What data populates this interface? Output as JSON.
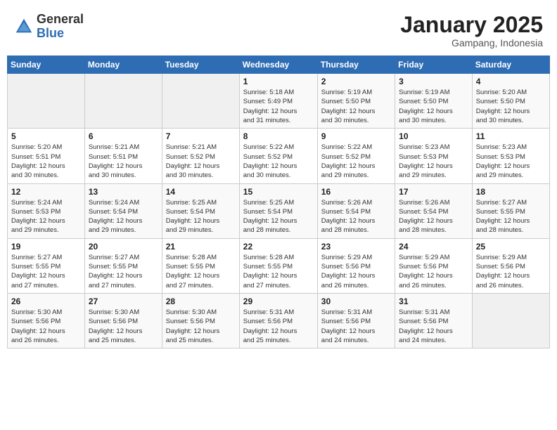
{
  "header": {
    "logo_general": "General",
    "logo_blue": "Blue",
    "month_title": "January 2025",
    "location": "Gampang, Indonesia"
  },
  "weekdays": [
    "Sunday",
    "Monday",
    "Tuesday",
    "Wednesday",
    "Thursday",
    "Friday",
    "Saturday"
  ],
  "weeks": [
    [
      {
        "day": "",
        "info": ""
      },
      {
        "day": "",
        "info": ""
      },
      {
        "day": "",
        "info": ""
      },
      {
        "day": "1",
        "info": "Sunrise: 5:18 AM\nSunset: 5:49 PM\nDaylight: 12 hours\nand 31 minutes."
      },
      {
        "day": "2",
        "info": "Sunrise: 5:19 AM\nSunset: 5:50 PM\nDaylight: 12 hours\nand 30 minutes."
      },
      {
        "day": "3",
        "info": "Sunrise: 5:19 AM\nSunset: 5:50 PM\nDaylight: 12 hours\nand 30 minutes."
      },
      {
        "day": "4",
        "info": "Sunrise: 5:20 AM\nSunset: 5:50 PM\nDaylight: 12 hours\nand 30 minutes."
      }
    ],
    [
      {
        "day": "5",
        "info": "Sunrise: 5:20 AM\nSunset: 5:51 PM\nDaylight: 12 hours\nand 30 minutes."
      },
      {
        "day": "6",
        "info": "Sunrise: 5:21 AM\nSunset: 5:51 PM\nDaylight: 12 hours\nand 30 minutes."
      },
      {
        "day": "7",
        "info": "Sunrise: 5:21 AM\nSunset: 5:52 PM\nDaylight: 12 hours\nand 30 minutes."
      },
      {
        "day": "8",
        "info": "Sunrise: 5:22 AM\nSunset: 5:52 PM\nDaylight: 12 hours\nand 30 minutes."
      },
      {
        "day": "9",
        "info": "Sunrise: 5:22 AM\nSunset: 5:52 PM\nDaylight: 12 hours\nand 29 minutes."
      },
      {
        "day": "10",
        "info": "Sunrise: 5:23 AM\nSunset: 5:53 PM\nDaylight: 12 hours\nand 29 minutes."
      },
      {
        "day": "11",
        "info": "Sunrise: 5:23 AM\nSunset: 5:53 PM\nDaylight: 12 hours\nand 29 minutes."
      }
    ],
    [
      {
        "day": "12",
        "info": "Sunrise: 5:24 AM\nSunset: 5:53 PM\nDaylight: 12 hours\nand 29 minutes."
      },
      {
        "day": "13",
        "info": "Sunrise: 5:24 AM\nSunset: 5:54 PM\nDaylight: 12 hours\nand 29 minutes."
      },
      {
        "day": "14",
        "info": "Sunrise: 5:25 AM\nSunset: 5:54 PM\nDaylight: 12 hours\nand 29 minutes."
      },
      {
        "day": "15",
        "info": "Sunrise: 5:25 AM\nSunset: 5:54 PM\nDaylight: 12 hours\nand 28 minutes."
      },
      {
        "day": "16",
        "info": "Sunrise: 5:26 AM\nSunset: 5:54 PM\nDaylight: 12 hours\nand 28 minutes."
      },
      {
        "day": "17",
        "info": "Sunrise: 5:26 AM\nSunset: 5:54 PM\nDaylight: 12 hours\nand 28 minutes."
      },
      {
        "day": "18",
        "info": "Sunrise: 5:27 AM\nSunset: 5:55 PM\nDaylight: 12 hours\nand 28 minutes."
      }
    ],
    [
      {
        "day": "19",
        "info": "Sunrise: 5:27 AM\nSunset: 5:55 PM\nDaylight: 12 hours\nand 27 minutes."
      },
      {
        "day": "20",
        "info": "Sunrise: 5:27 AM\nSunset: 5:55 PM\nDaylight: 12 hours\nand 27 minutes."
      },
      {
        "day": "21",
        "info": "Sunrise: 5:28 AM\nSunset: 5:55 PM\nDaylight: 12 hours\nand 27 minutes."
      },
      {
        "day": "22",
        "info": "Sunrise: 5:28 AM\nSunset: 5:55 PM\nDaylight: 12 hours\nand 27 minutes."
      },
      {
        "day": "23",
        "info": "Sunrise: 5:29 AM\nSunset: 5:56 PM\nDaylight: 12 hours\nand 26 minutes."
      },
      {
        "day": "24",
        "info": "Sunrise: 5:29 AM\nSunset: 5:56 PM\nDaylight: 12 hours\nand 26 minutes."
      },
      {
        "day": "25",
        "info": "Sunrise: 5:29 AM\nSunset: 5:56 PM\nDaylight: 12 hours\nand 26 minutes."
      }
    ],
    [
      {
        "day": "26",
        "info": "Sunrise: 5:30 AM\nSunset: 5:56 PM\nDaylight: 12 hours\nand 26 minutes."
      },
      {
        "day": "27",
        "info": "Sunrise: 5:30 AM\nSunset: 5:56 PM\nDaylight: 12 hours\nand 25 minutes."
      },
      {
        "day": "28",
        "info": "Sunrise: 5:30 AM\nSunset: 5:56 PM\nDaylight: 12 hours\nand 25 minutes."
      },
      {
        "day": "29",
        "info": "Sunrise: 5:31 AM\nSunset: 5:56 PM\nDaylight: 12 hours\nand 25 minutes."
      },
      {
        "day": "30",
        "info": "Sunrise: 5:31 AM\nSunset: 5:56 PM\nDaylight: 12 hours\nand 24 minutes."
      },
      {
        "day": "31",
        "info": "Sunrise: 5:31 AM\nSunset: 5:56 PM\nDaylight: 12 hours\nand 24 minutes."
      },
      {
        "day": "",
        "info": ""
      }
    ]
  ]
}
